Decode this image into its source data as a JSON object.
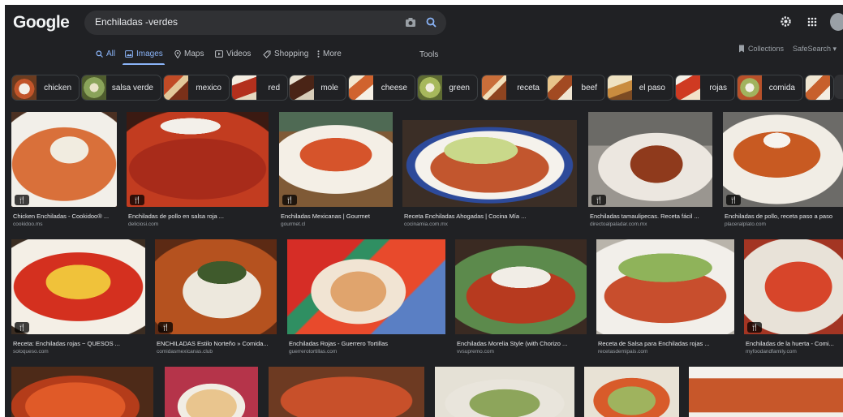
{
  "header": {
    "logo": "Google",
    "query": "Enchiladas -verdes",
    "icons": [
      "camera-icon",
      "search-icon",
      "gear-icon",
      "apps-icon",
      "avatar"
    ]
  },
  "tabs": [
    {
      "label": "All",
      "icon": "search-icon",
      "active": false
    },
    {
      "label": "Images",
      "icon": "image-icon",
      "active": true
    },
    {
      "label": "Maps",
      "icon": "pin-icon",
      "active": false
    },
    {
      "label": "Videos",
      "icon": "play-icon",
      "active": false
    },
    {
      "label": "Shopping",
      "icon": "tag-icon",
      "active": false
    },
    {
      "label": "More",
      "icon": "dots-icon",
      "active": false
    }
  ],
  "tools_label": "Tools",
  "collections_label": "Collections",
  "safesearch_label": "SafeSearch",
  "chips": [
    "chicken",
    "salsa verde",
    "mexico",
    "red",
    "mole",
    "cheese",
    "green",
    "receta",
    "beef",
    "el paso",
    "rojas",
    "comida"
  ],
  "results": [
    {
      "title": "Chicken Enchiladas - Cookidoo® ...",
      "source": "cookidoo.ms"
    },
    {
      "title": "Enchiladas de pollo en salsa roja ...",
      "source": "deliciosi.com"
    },
    {
      "title": "Enchiladas Mexicanas | Gourmet",
      "source": "gourmet.cl"
    },
    {
      "title": "Receta Enchiladas Ahogadas | Cocina Mía ...",
      "source": "cocinamia.com.mx"
    },
    {
      "title": "Enchiladas tamaulipecas. Receta fácil ...",
      "source": "directoalpaladar.com.mx"
    },
    {
      "title": "Enchiladas de pollo, receta paso a paso",
      "source": "placeralplato.com"
    },
    {
      "title": "Receta: Enchiladas rojas ~ QUESOS ...",
      "source": "soloqueso.com"
    },
    {
      "title": "ENCHILADAS Estilo Norteño » Comida...",
      "source": "comidasmexicanas.club"
    },
    {
      "title": "Enchiladas Rojas - Guerrero Tortillas",
      "source": "guerrerotortillas.com"
    },
    {
      "title": "Enchiladas Morelia Style (with Chorizo ...",
      "source": "vvsupremo.com"
    },
    {
      "title": "Receta de Salsa para Enchiladas rojas ...",
      "source": "recetasdemipais.com"
    },
    {
      "title": "Enchiladas de la huerta - Comi...",
      "source": "myfoodandfamily.com"
    }
  ],
  "recipe_badge": "🍴",
  "colors": {
    "background": "#202124",
    "accent": "#8ab4f8",
    "text": "#e8eaed",
    "muted": "#9aa0a6"
  }
}
